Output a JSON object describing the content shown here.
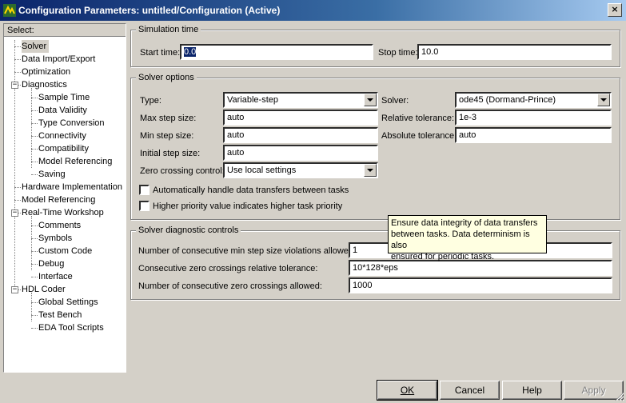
{
  "window": {
    "title": "Configuration Parameters: untitled/Configuration (Active)",
    "close_glyph": "×"
  },
  "tree": {
    "header": "Select:",
    "items": [
      {
        "label": "Solver",
        "level": 1
      },
      {
        "label": "Data Import/Export",
        "level": 1
      },
      {
        "label": "Optimization",
        "level": 1
      },
      {
        "label": "Diagnostics",
        "level": 1,
        "expander": "−"
      },
      {
        "label": "Sample Time",
        "level": 2
      },
      {
        "label": "Data Validity",
        "level": 2
      },
      {
        "label": "Type Conversion",
        "level": 2
      },
      {
        "label": "Connectivity",
        "level": 2
      },
      {
        "label": "Compatibility",
        "level": 2
      },
      {
        "label": "Model Referencing",
        "level": 2
      },
      {
        "label": "Saving",
        "level": 2
      },
      {
        "label": "Hardware Implementation",
        "level": 1
      },
      {
        "label": "Model Referencing",
        "level": 1
      },
      {
        "label": "Real-Time Workshop",
        "level": 1,
        "expander": "−"
      },
      {
        "label": "Comments",
        "level": 2
      },
      {
        "label": "Symbols",
        "level": 2
      },
      {
        "label": "Custom Code",
        "level": 2
      },
      {
        "label": "Debug",
        "level": 2
      },
      {
        "label": "Interface",
        "level": 2
      },
      {
        "label": "HDL Coder",
        "level": 1,
        "expander": "−"
      },
      {
        "label": "Global Settings",
        "level": 2
      },
      {
        "label": "Test Bench",
        "level": 2
      },
      {
        "label": "EDA Tool Scripts",
        "level": 2
      }
    ]
  },
  "simulation_time": {
    "title": "Simulation time",
    "start_label": "Start time:",
    "start_value": "0.0",
    "stop_label": "Stop time:",
    "stop_value": "10.0"
  },
  "solver_options": {
    "title": "Solver options",
    "type_label": "Type:",
    "type_value": "Variable-step",
    "solver_label": "Solver:",
    "solver_value": "ode45 (Dormand-Prince)",
    "max_step_label": "Max step size:",
    "max_step_value": "auto",
    "rel_tol_label": "Relative tolerance:",
    "rel_tol_value": "1e-3",
    "min_step_label": "Min step size:",
    "min_step_value": "auto",
    "abs_tol_label": "Absolute tolerance:",
    "abs_tol_value": "auto",
    "init_step_label": "Initial step size:",
    "init_step_value": "auto",
    "zero_cross_label": "Zero crossing control:",
    "zero_cross_value": "Use local settings",
    "check1_label": "Automatically handle data transfers between tasks",
    "check2_label": "Higher priority value indicates higher task priority"
  },
  "tooltip": {
    "line1": "Ensure data integrity of data transfers",
    "line2": "between tasks. Data determinism is also",
    "line3": "ensured for periodic tasks."
  },
  "diagnostic_controls": {
    "title": "Solver diagnostic controls",
    "min_step_viol_label": "Number of consecutive min step size violations allowed:",
    "min_step_viol_value": "1",
    "zc_tol_label": "Consecutive zero crossings relative tolerance:",
    "zc_tol_value": "10*128*eps",
    "zc_allowed_label": "Number of consecutive zero crossings allowed:",
    "zc_allowed_value": "1000"
  },
  "buttons": {
    "ok": "OK",
    "cancel": "Cancel",
    "help": "Help",
    "apply": "Apply"
  }
}
